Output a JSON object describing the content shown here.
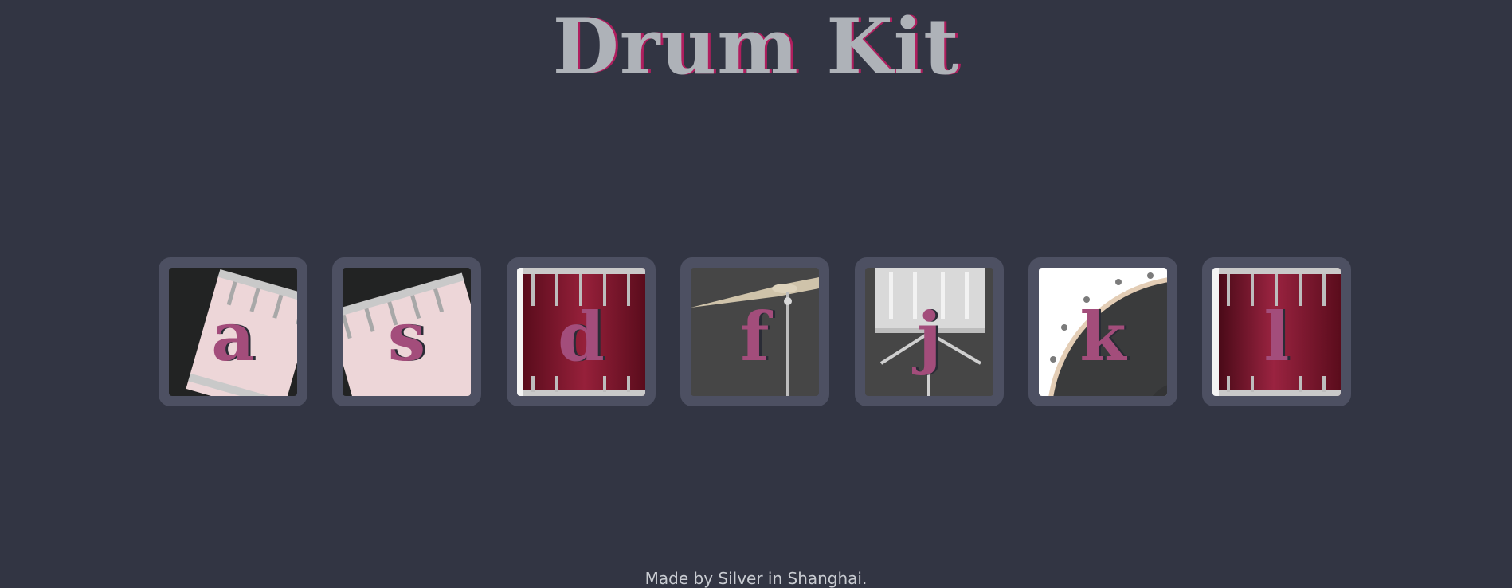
{
  "page": {
    "title": "Drum Kit",
    "footer": "Made by Silver in Shanghai."
  },
  "drums": [
    {
      "key": "a",
      "image": "tom-1-drum-icon"
    },
    {
      "key": "s",
      "image": "tom-2-drum-icon"
    },
    {
      "key": "d",
      "image": "tom-3-drum-icon"
    },
    {
      "key": "f",
      "image": "crash-cymbal-icon"
    },
    {
      "key": "j",
      "image": "snare-drum-icon"
    },
    {
      "key": "k",
      "image": "kick-drum-icon"
    },
    {
      "key": "l",
      "image": "tom-4-drum-icon"
    }
  ],
  "colors": {
    "background": "#323543",
    "tile": "#4d5062",
    "title": "#aeb2b8",
    "title_shadow": "#b01e5e",
    "key_letter": "#a34d7b"
  }
}
